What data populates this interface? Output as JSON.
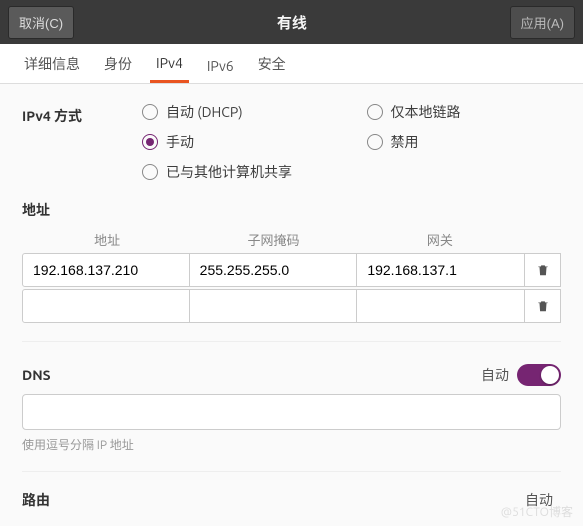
{
  "header": {
    "cancel": "取消(C)",
    "title": "有线",
    "apply": "应用(A)"
  },
  "tabs": [
    {
      "label": "详细信息",
      "active": false
    },
    {
      "label": "身份",
      "active": false
    },
    {
      "label": "IPv4",
      "active": true
    },
    {
      "label": "IPv6",
      "active": false
    },
    {
      "label": "安全",
      "active": false
    }
  ],
  "ipv4": {
    "method_label": "IPv4 方式",
    "methods": [
      {
        "label": "自动 (DHCP)",
        "checked": false
      },
      {
        "label": "仅本地链路",
        "checked": false
      },
      {
        "label": "手动",
        "checked": true
      },
      {
        "label": "禁用",
        "checked": false
      },
      {
        "label": "已与其他计算机共享",
        "checked": false
      }
    ],
    "addr_title": "地址",
    "addr_cols": {
      "c1": "地址",
      "c2": "子网掩码",
      "c3": "网关"
    },
    "addr_rows": [
      {
        "address": "192.168.137.210",
        "netmask": "255.255.255.0",
        "gateway": "192.168.137.1"
      },
      {
        "address": "",
        "netmask": "",
        "gateway": ""
      }
    ],
    "dns_title": "DNS",
    "auto_label": "自动",
    "dns_value": "",
    "dns_hint": "使用逗号分隔 IP 地址",
    "route_title": "路由",
    "route_auto": "自动"
  },
  "watermark": "@51CTO博客"
}
